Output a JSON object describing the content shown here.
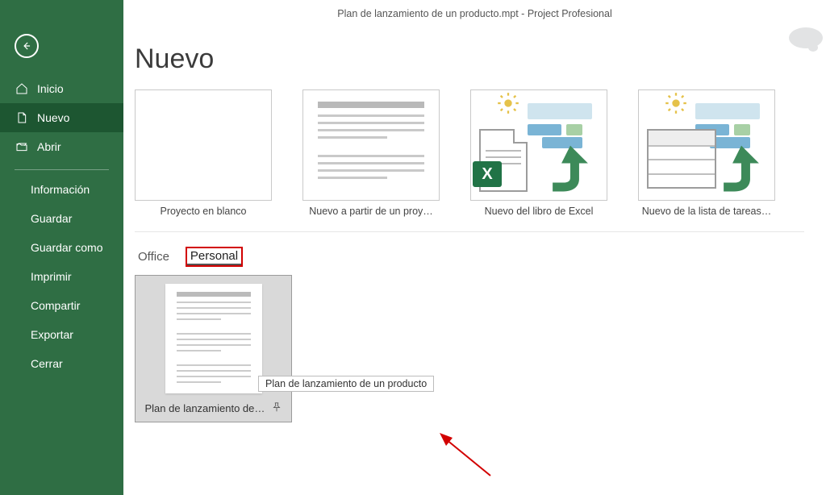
{
  "titlebar": {
    "doc_name": "Plan de lanzamiento de un producto.mpt",
    "separator": " - ",
    "app_name": "Project Profesional"
  },
  "sidebar": {
    "primary": [
      {
        "label": "Inicio",
        "icon": "home-icon"
      },
      {
        "label": "Nuevo",
        "icon": "document-icon"
      },
      {
        "label": "Abrir",
        "icon": "folder-icon"
      }
    ],
    "secondary": [
      {
        "label": "Información"
      },
      {
        "label": "Guardar"
      },
      {
        "label": "Guardar como"
      },
      {
        "label": "Imprimir"
      },
      {
        "label": "Compartir"
      },
      {
        "label": "Exportar"
      },
      {
        "label": "Cerrar"
      }
    ]
  },
  "page_title": "Nuevo",
  "templates": [
    {
      "label": "Proyecto en blanco"
    },
    {
      "label": "Nuevo a partir de un proy…"
    },
    {
      "label": "Nuevo del libro de Excel"
    },
    {
      "label": "Nuevo de la lista de tareas…"
    }
  ],
  "tabs": {
    "office": "Office",
    "personal": "Personal"
  },
  "personal_template": {
    "label": "Plan de lanzamiento de u…",
    "tooltip": "Plan de lanzamiento de un producto"
  },
  "excel_badge": "X"
}
